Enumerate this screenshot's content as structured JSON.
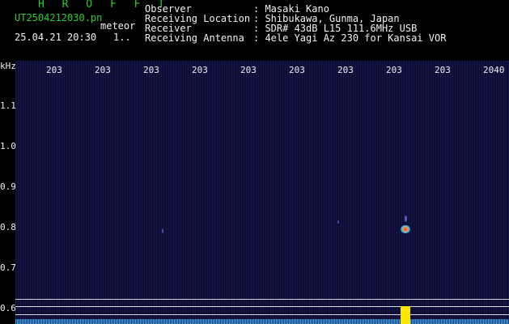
{
  "header": {
    "title": "H R O F F T",
    "filename": "UT2504212030.pn",
    "detector": "meteor",
    "datetime": "25.04.21 20:30",
    "count": "1..",
    "info": [
      {
        "key": "Observer",
        "value": ": Masaki Kano"
      },
      {
        "key": "Receiving Location",
        "value": ": Shibukawa, Gunma, Japan"
      },
      {
        "key": "Receiver",
        "value": ": SDR# 43dB L15 111.6MHz USB"
      },
      {
        "key": "Receiving Antenna",
        "value": ": 4ele Yagi Az 230 for Kansai VOR"
      }
    ]
  },
  "axes": {
    "y_unit": "kHz",
    "x_ticks": [
      "203",
      "203",
      "203",
      "203",
      "203",
      "203",
      "203",
      "203",
      "203",
      "2040"
    ],
    "y_ticks": [
      "1.1",
      "1.0",
      "0.9",
      "0.8",
      "0.7",
      "0.6"
    ]
  },
  "colors": {
    "background": "#000000",
    "plot_bg": "#0c0c33",
    "title": "#2ecc2e",
    "text": "#f2f2f2",
    "signal_hot": "#ff3030",
    "signal_warm": "#ffe600",
    "signal_cool": "#30c0ff"
  }
}
